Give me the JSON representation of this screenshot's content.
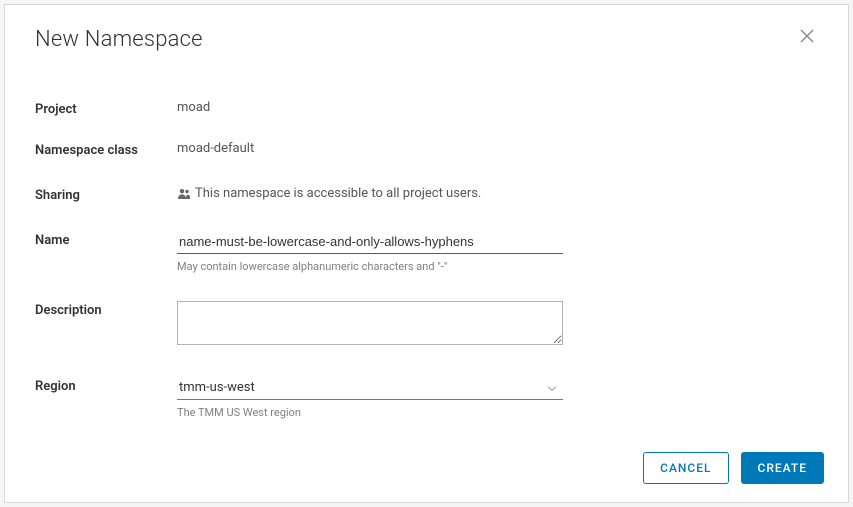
{
  "dialog": {
    "title": "New Namespace"
  },
  "fields": {
    "project": {
      "label": "Project",
      "value": "moad"
    },
    "namespace_class": {
      "label": "Namespace class",
      "value": "moad-default"
    },
    "sharing": {
      "label": "Sharing",
      "text": "This namespace is accessible to all project users."
    },
    "name": {
      "label": "Name",
      "value": "name-must-be-lowercase-and-only-allows-hyphens",
      "helper": "May contain lowercase alphanumeric characters and \"-\""
    },
    "description": {
      "label": "Description",
      "value": ""
    },
    "region": {
      "label": "Region",
      "selected": "tmm-us-west",
      "helper": "The TMM US West region"
    }
  },
  "buttons": {
    "cancel": "CANCEL",
    "create": "CREATE"
  }
}
